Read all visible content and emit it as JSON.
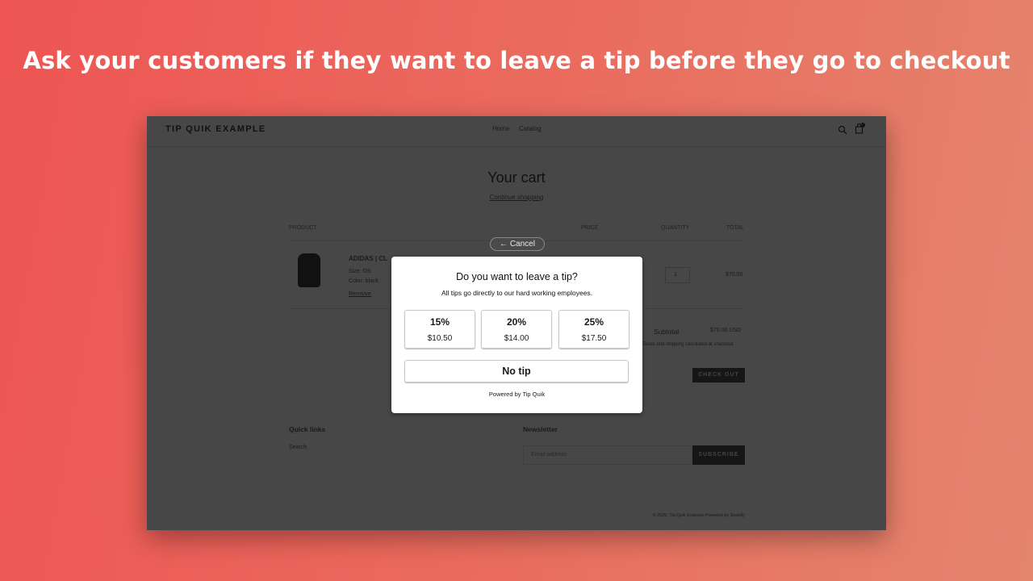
{
  "headline": "Ask your customers if they want to leave a tip before they go to checkout",
  "store": {
    "logo": "TIP QUIK EXAMPLE",
    "nav": [
      "Home",
      "Catalog"
    ],
    "cart_count": "1",
    "cart": {
      "title": "Your cart",
      "continue": "Continue shopping",
      "headers": {
        "product": "PRODUCT",
        "price": "PRICE",
        "quantity": "QUANTITY",
        "total": "TOTAL"
      },
      "item": {
        "name": "ADIDAS | CL",
        "size": "Size: OS",
        "color": "Color: black",
        "remove": "Remove",
        "quantity": "1",
        "total": "$70.00"
      },
      "subtotal_label": "Subtotal",
      "subtotal": "$70.00 USD",
      "tax_note": "Taxes and shipping calculated at checkout",
      "checkout": "CHECK OUT"
    },
    "footer": {
      "quick_links": "Quick links",
      "search": "Search",
      "newsletter": "Newsletter",
      "email_placeholder": "Email address",
      "subscribe": "SUBSCRIBE",
      "copyright": "© 2020, Tip Quik Example Powered by Shopify"
    }
  },
  "modal": {
    "cancel": "← Cancel",
    "title": "Do you want to leave a tip?",
    "subtitle": "All tips go directly to our hard working employees.",
    "options": [
      {
        "pct": "15%",
        "amt": "$10.50"
      },
      {
        "pct": "20%",
        "amt": "$14.00"
      },
      {
        "pct": "25%",
        "amt": "$17.50"
      }
    ],
    "no_tip": "No tip",
    "powered": "Powered by Tip Quik"
  }
}
